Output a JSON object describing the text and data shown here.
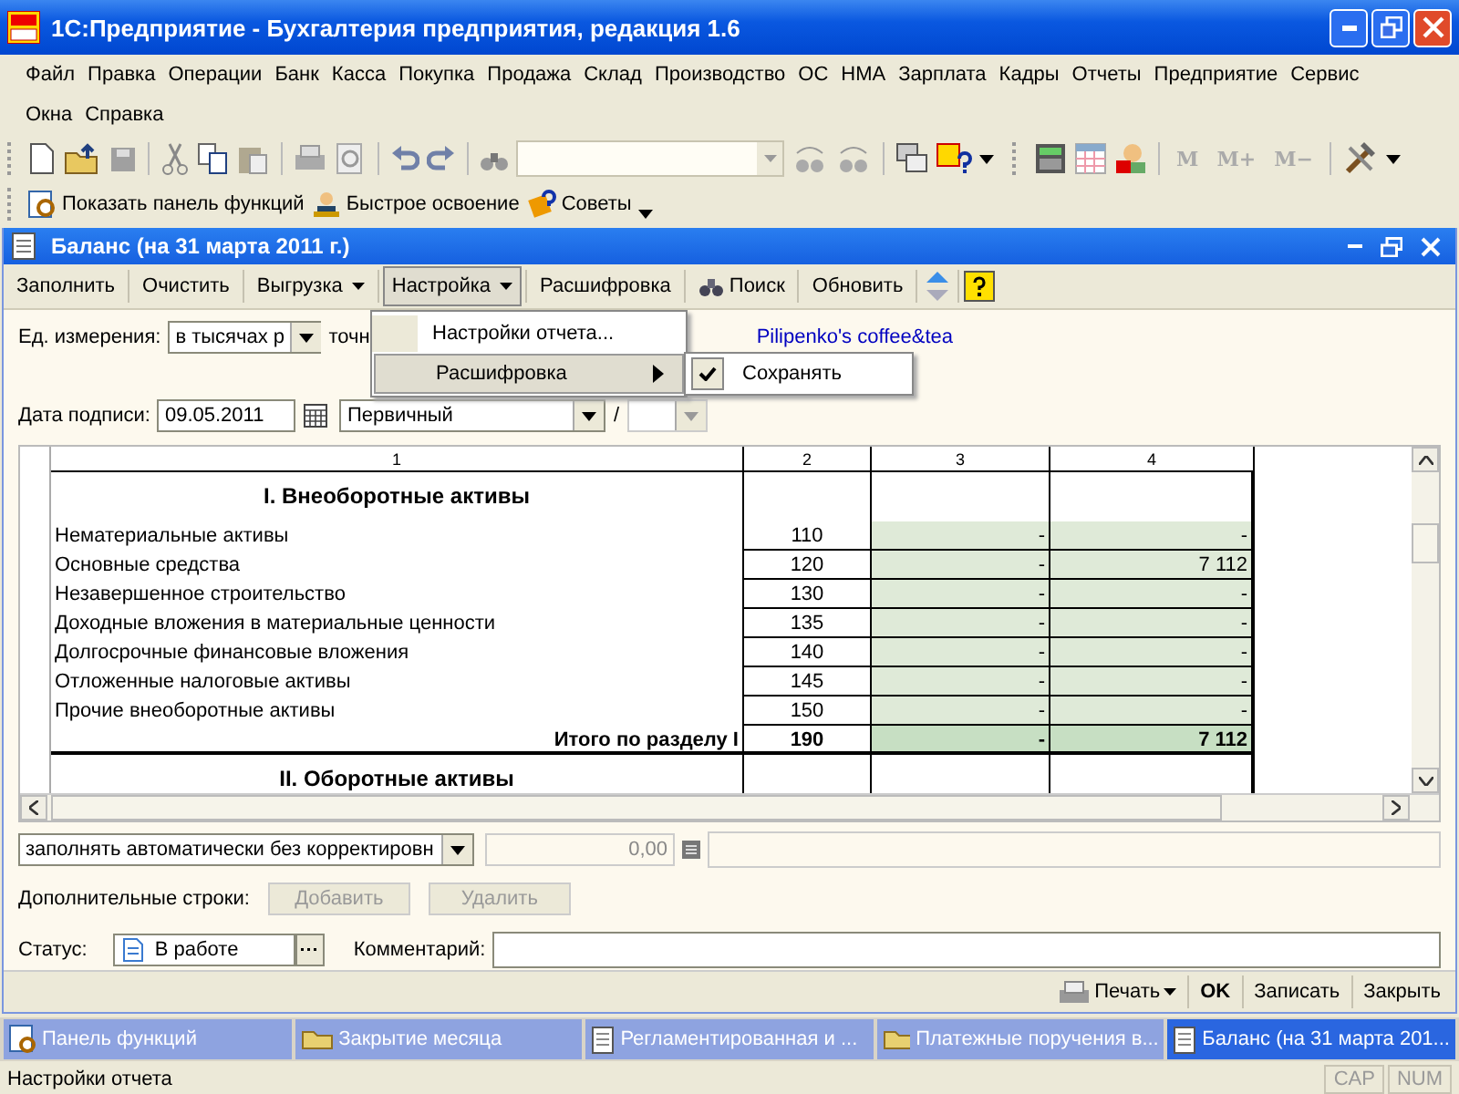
{
  "window": {
    "title": "1С:Предприятие - Бухгалтерия предприятия, редакция 1.6"
  },
  "menu": [
    "Файл",
    "Правка",
    "Операции",
    "Банк",
    "Касса",
    "Покупка",
    "Продажа",
    "Склад",
    "Производство",
    "ОС",
    "НМА",
    "Зарплата",
    "Кадры",
    "Отчеты",
    "Предприятие",
    "Сервис",
    "Окна",
    "Справка"
  ],
  "memory_buttons": [
    "M",
    "M+",
    "M−"
  ],
  "quick_bar": [
    "Показать панель функций",
    "Быстрое освоение",
    "Советы"
  ],
  "document": {
    "title": "Баланс (на 31 марта 2011 г.)",
    "commands": [
      {
        "label": "Заполнить",
        "dropdown": false,
        "selected": false
      },
      {
        "label": "Очистить",
        "dropdown": false,
        "selected": false
      },
      {
        "label": "Выгрузка",
        "dropdown": true,
        "selected": false
      },
      {
        "label": "Настройка",
        "dropdown": true,
        "selected": true
      },
      {
        "label": "Расшифровка",
        "dropdown": false,
        "selected": false
      },
      {
        "label": "Поиск",
        "dropdown": false,
        "selected": false
      },
      {
        "label": "Обновить",
        "dropdown": false,
        "selected": false
      }
    ],
    "menu": [
      {
        "label": "Настройки отчета...",
        "submenu": false,
        "selected": false
      },
      {
        "label": "Расшифровка",
        "submenu": true,
        "selected": true
      }
    ],
    "submenu": {
      "label": "Сохранять",
      "checked": true
    },
    "unit_label": "Ед. измерения:",
    "unit_value": "в тысячах р",
    "precision_label": "точн",
    "org_link": "Pilipenko's coffee&tea",
    "date_label": "Дата подписи:",
    "date_value": "09.05.2011",
    "kind_value": "Первичный",
    "slash": "/",
    "table": {
      "columns": [
        "1",
        "2",
        "3",
        "4"
      ],
      "rows": [
        {
          "kind": "section",
          "label": "I. Внеоборотные активы"
        },
        {
          "kind": "item",
          "label": "Нематериальные активы",
          "code": "110",
          "col3": "-",
          "col4": "-"
        },
        {
          "kind": "item",
          "label": "Основные средства",
          "code": "120",
          "col3": "-",
          "col4": "7 112"
        },
        {
          "kind": "item",
          "label": "Незавершенное строительство",
          "code": "130",
          "col3": "-",
          "col4": "-"
        },
        {
          "kind": "item",
          "label": "Доходные вложения в материальные ценности",
          "code": "135",
          "col3": "-",
          "col4": "-"
        },
        {
          "kind": "item",
          "label": "Долгосрочные финансовые вложения",
          "code": "140",
          "col3": "-",
          "col4": "-"
        },
        {
          "kind": "item",
          "label": "Отложенные налоговые активы",
          "code": "145",
          "col3": "-",
          "col4": "-"
        },
        {
          "kind": "item",
          "label": "Прочие внеоборотные активы",
          "code": "150",
          "col3": "-",
          "col4": "-"
        },
        {
          "kind": "total",
          "label": "Итого по разделу I",
          "code": "190",
          "col3": "-",
          "col4": "7 112"
        },
        {
          "kind": "section",
          "label": "II. Оборотные активы"
        }
      ]
    },
    "fill_mode": "заполнять автоматически без корректировн",
    "amount": "0,00",
    "extra_label": "Дополнительные строки:",
    "extra_buttons": [
      {
        "label": "Добавить",
        "disabled": true
      },
      {
        "label": "Удалить",
        "disabled": true
      }
    ],
    "status_label": "Статус:",
    "status_value": "В работе",
    "comment_label": "Комментарий:",
    "footer_buttons": [
      {
        "label": "Печать",
        "kind": "print"
      },
      {
        "label": "OK",
        "kind": "bold"
      },
      {
        "label": "Записать",
        "kind": "plain"
      },
      {
        "label": "Закрыть",
        "kind": "plain"
      }
    ]
  },
  "taskbar": [
    {
      "label": "Панель функций",
      "selected": false,
      "kind": "panel"
    },
    {
      "label": "Закрытие месяца",
      "selected": false,
      "kind": "folder"
    },
    {
      "label": "Регламентированная и ...",
      "selected": false,
      "kind": "doc"
    },
    {
      "label": "Платежные поручения в...",
      "selected": false,
      "kind": "folder"
    },
    {
      "label": "Баланс (на 31 марта 201...",
      "selected": true,
      "kind": "doc"
    }
  ],
  "status_bar": {
    "text": "Настройки отчета",
    "indicators": [
      "CAP",
      "NUM"
    ]
  }
}
